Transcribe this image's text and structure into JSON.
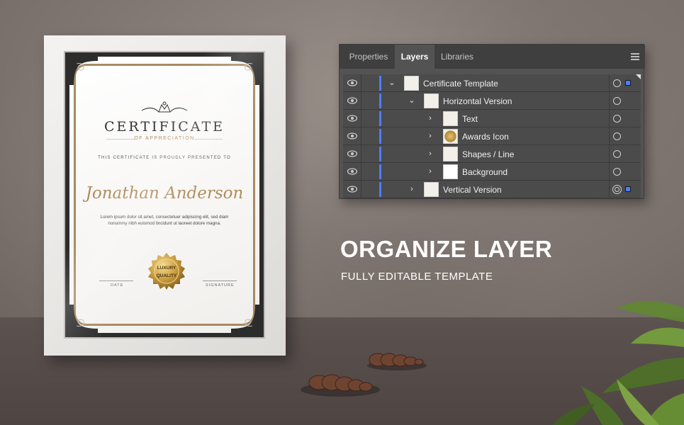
{
  "certificate": {
    "title": "CERTIFICATE",
    "subtitle": "OF APPRECIATION",
    "presented": "THIS CERTIFICATE IS PROUDLY PRESENTED TO",
    "name": "Jonathan Anderson",
    "body_line1": "Lorem ipsum dolor sit amet, consectetuer adipiscing elit, sed diam",
    "body_line2": "nonummy nibh euismod tincidunt ut laoreet dolore magna.",
    "date_label": "DATE",
    "signature_label": "SIGNATURE",
    "seal_top": "LUXURY",
    "seal_bottom": "QUALITY",
    "accent_color": "#b08c5a"
  },
  "panel": {
    "tabs": [
      {
        "label": "Properties",
        "active": false
      },
      {
        "label": "Layers",
        "active": true
      },
      {
        "label": "Libraries",
        "active": false
      }
    ],
    "layers": [
      {
        "name": "Certificate Template",
        "expanded": true,
        "icon": "chevron-down-icon"
      },
      {
        "name": "Horizontal Version",
        "expanded": true,
        "icon": "chevron-down-icon"
      },
      {
        "name": "Text",
        "expanded": false,
        "icon": "chevron-right-icon"
      },
      {
        "name": "Awards Icon",
        "expanded": false,
        "icon": "chevron-right-icon"
      },
      {
        "name": "Shapes / Line",
        "expanded": false,
        "icon": "chevron-right-icon"
      },
      {
        "name": "Background",
        "expanded": false,
        "icon": "chevron-right-icon"
      },
      {
        "name": "Vertical Version",
        "expanded": false,
        "icon": "chevron-right-icon"
      }
    ],
    "layer_color": "#4c7dff"
  },
  "headline": "ORGANIZE LAYER",
  "subline": "FULLY EDITABLE TEMPLATE"
}
